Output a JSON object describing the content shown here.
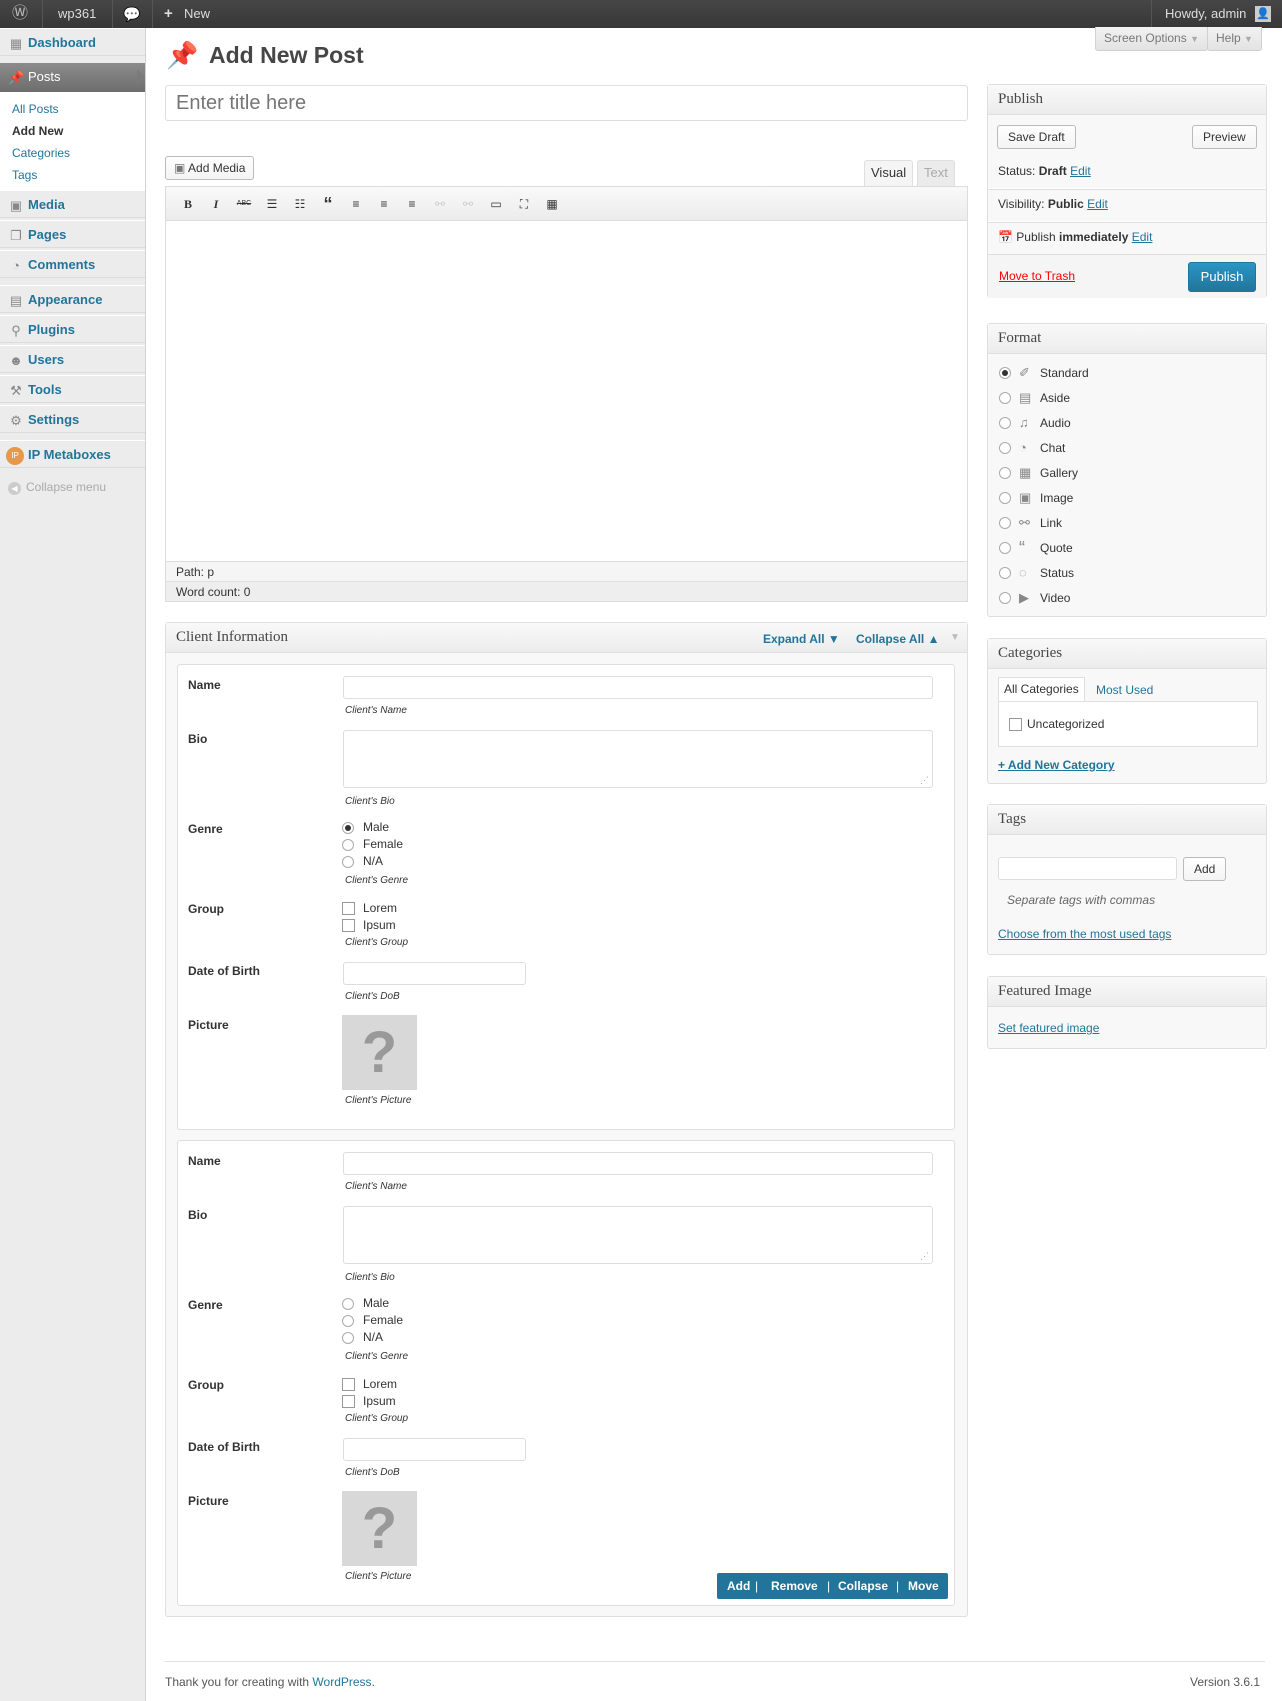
{
  "adminbar": {
    "site_name": "wp361",
    "new_label": "New",
    "howdy": "Howdy, admin"
  },
  "sidebar": {
    "items": [
      {
        "label": "Dashboard",
        "icon": "dashboard-icon"
      },
      {
        "label": "Posts",
        "icon": "pin-icon"
      },
      {
        "label": "Media",
        "icon": "media-icon"
      },
      {
        "label": "Pages",
        "icon": "pages-icon"
      },
      {
        "label": "Comments",
        "icon": "comments-icon"
      },
      {
        "label": "Appearance",
        "icon": "appearance-icon"
      },
      {
        "label": "Plugins",
        "icon": "plugins-icon"
      },
      {
        "label": "Users",
        "icon": "users-icon"
      },
      {
        "label": "Tools",
        "icon": "tools-icon"
      },
      {
        "label": "Settings",
        "icon": "settings-icon"
      },
      {
        "label": "IP Metaboxes",
        "icon": "ip-metaboxes-icon"
      }
    ],
    "submenu": [
      "All Posts",
      "Add New",
      "Categories",
      "Tags"
    ],
    "collapse": "Collapse menu"
  },
  "header": {
    "title": "Add New Post",
    "screen_options": "Screen Options",
    "help": "Help"
  },
  "title_field": {
    "placeholder": "Enter title here"
  },
  "editor": {
    "add_media": "Add Media",
    "tab_visual": "Visual",
    "tab_text": "Text",
    "toolbar": [
      "B",
      "I",
      "ABC",
      "☰",
      "☷",
      "“",
      "≡",
      "≡",
      "≡",
      "⚯",
      "⚯",
      "▭",
      "⛶",
      "▦"
    ],
    "path": "Path: p",
    "word_count": "Word count: 0"
  },
  "publish": {
    "title": "Publish",
    "save_draft": "Save Draft",
    "preview": "Preview",
    "status_label": "Status:",
    "status_value": "Draft",
    "visibility_label": "Visibility:",
    "visibility_value": "Public",
    "publish_label": "Publish",
    "publish_value": "immediately",
    "edit": "Edit",
    "trash": "Move to Trash",
    "publish_button": "Publish"
  },
  "format": {
    "title": "Format",
    "options": [
      "Standard",
      "Aside",
      "Audio",
      "Chat",
      "Gallery",
      "Image",
      "Link",
      "Quote",
      "Status",
      "Video"
    ],
    "selected": "Standard"
  },
  "categories": {
    "title": "Categories",
    "tab_all": "All Categories",
    "tab_most": "Most Used",
    "items": [
      "Uncategorized"
    ],
    "add_new": "+ Add New Category"
  },
  "tags": {
    "title": "Tags",
    "add": "Add",
    "hint": "Separate tags with commas",
    "choose": "Choose from the most used tags"
  },
  "featured": {
    "title": "Featured Image",
    "set": "Set featured image"
  },
  "client": {
    "title": "Client Information",
    "expand_all": "Expand All ▼",
    "collapse_all": "Collapse All ▲",
    "labels": {
      "name": "Name",
      "bio": "Bio",
      "genre": "Genre",
      "group": "Group",
      "dob": "Date of Birth",
      "picture": "Picture"
    },
    "descs": {
      "name": "Client's Name",
      "bio": "Client's Bio",
      "genre": "Client's Genre",
      "group": "Client's Group",
      "dob": "Client's DoB",
      "picture": "Client's Picture"
    },
    "genre_options": [
      "Male",
      "Female",
      "N/A"
    ],
    "group_options": [
      "Lorem",
      "Ipsum"
    ],
    "actions": [
      "Add",
      "Remove",
      "Collapse",
      "Move"
    ]
  },
  "footer": {
    "thanks": "Thank you for creating with",
    "wp": "WordPress",
    "version": "Version 3.6.1"
  }
}
